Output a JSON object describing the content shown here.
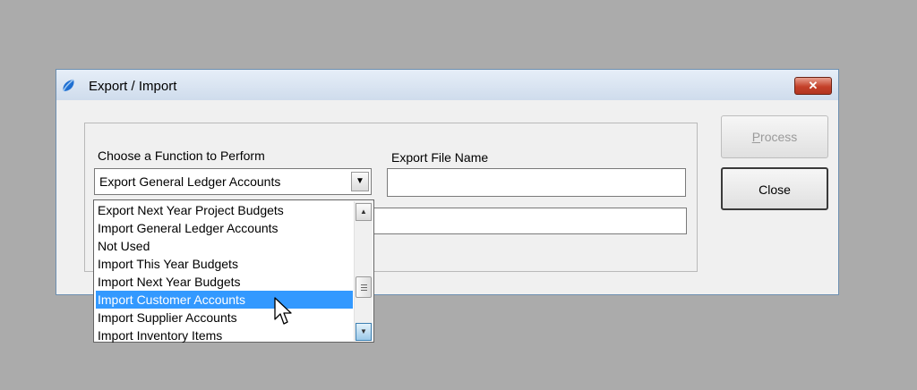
{
  "window": {
    "title": "Export / Import",
    "close_glyph": "✕"
  },
  "form": {
    "function_label": "Choose a Function to Perform",
    "file_label": "Export File Name",
    "selected_function": "Export General Ledger Accounts",
    "file_name_value": "",
    "path_value": ""
  },
  "buttons": {
    "process": "Process",
    "close": "Close"
  },
  "dropdown": {
    "items": [
      "Export Next Year Project Budgets",
      "Import General Ledger Accounts",
      "Not Used",
      "Import This Year Budgets",
      "Import Next Year Budgets",
      "Import Customer Accounts",
      "Import Supplier Accounts",
      "Import Inventory Items"
    ],
    "highlighted": "Import Customer Accounts"
  },
  "icons": {
    "app": "app-logo-icon",
    "combo_arrow": "chevron-down-icon",
    "cursor": "mouse-pointer-icon"
  },
  "colors": {
    "selection": "#3399ff",
    "close_button": "#c4412a"
  }
}
